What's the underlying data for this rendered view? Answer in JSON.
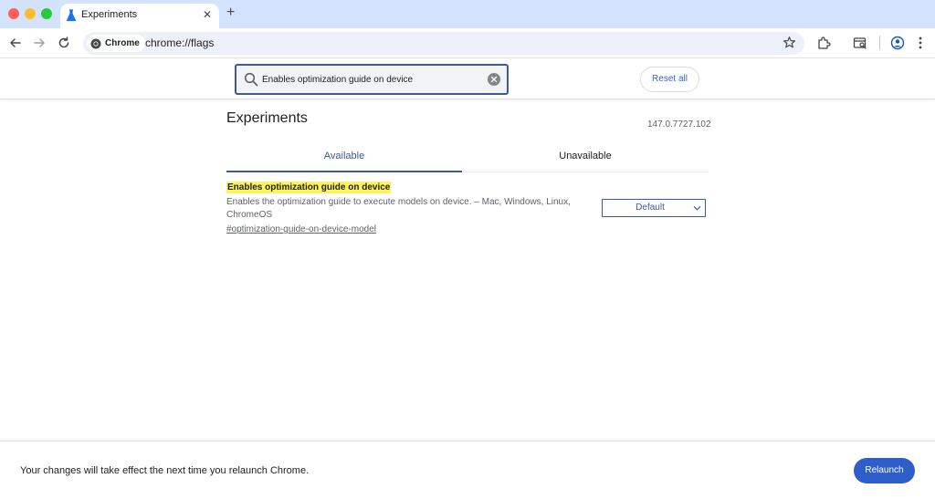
{
  "browser": {
    "tab_title": "Experiments",
    "new_tab_icon": "plus-icon",
    "chip_label": "Chrome",
    "url": "chrome://flags"
  },
  "header": {
    "search_value": "Enables optimization guide on device",
    "reset_label": "Reset all"
  },
  "main": {
    "title": "Experiments",
    "version": "147.0.7727.102",
    "tabs": [
      {
        "label": "Available",
        "selected": true
      },
      {
        "label": "Unavailable",
        "selected": false
      }
    ],
    "flag": {
      "name": "Enables optimization guide on device",
      "description": "Enables the optimization guide to execute models on device. – Mac, Windows, Linux, ChromeOS",
      "link": "#optimization-guide-on-device-model",
      "select_value": "Default"
    }
  },
  "footer": {
    "message": "Your changes will take effect the next time you relaunch Chrome.",
    "relaunch_label": "Relaunch"
  },
  "colors": {
    "tabstrip": "#d3e3fd",
    "accent": "#3c5a9a",
    "highlight": "#fff35a",
    "relaunch": "#2d5ec9"
  }
}
